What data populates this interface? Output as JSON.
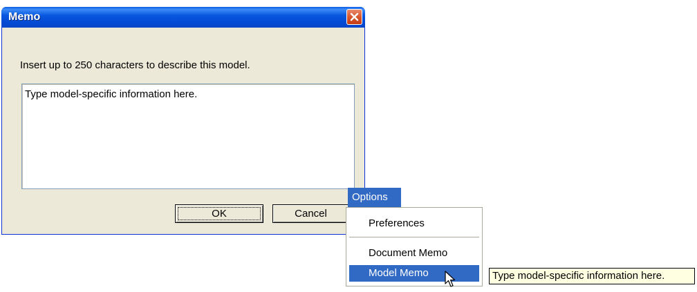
{
  "dialog": {
    "title": "Memo",
    "prompt": "Insert up to 250 characters to describe this model.",
    "memo_text": "Type model-specific information here.",
    "ok_label": "OK",
    "cancel_label": "Cancel"
  },
  "menu": {
    "title": "Options",
    "items": [
      {
        "label": "Preferences"
      },
      {
        "label": "Document Memo"
      },
      {
        "label": "Model Memo",
        "selected": true
      }
    ]
  },
  "tooltip": {
    "text": "Type model-specific information here."
  },
  "colors": {
    "titlebar": "#0a58e0",
    "dialog_bg": "#ece9d8",
    "selection": "#316ac5",
    "tooltip_bg": "#ffffe1",
    "close_button": "#d9572e"
  },
  "icons": {
    "close": "close-icon",
    "cursor": "mouse-pointer-icon"
  }
}
